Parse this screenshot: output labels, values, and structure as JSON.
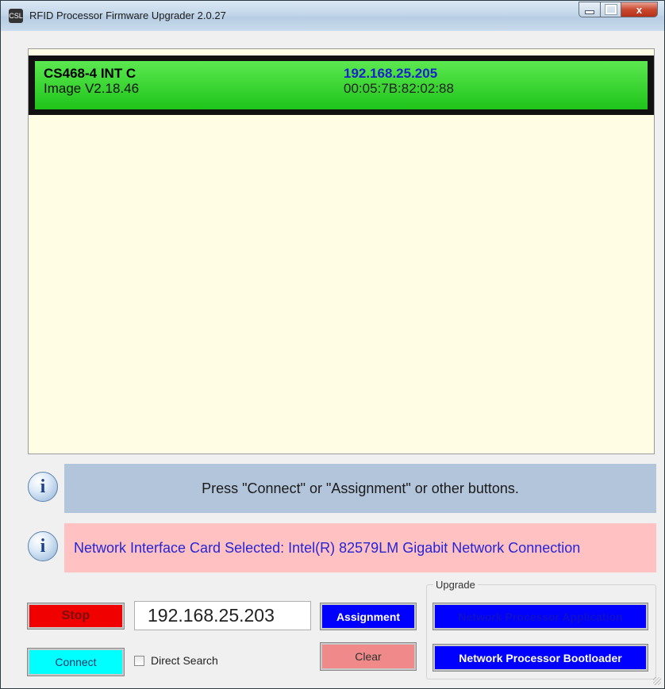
{
  "window": {
    "title": "RFID Processor Firmware Upgrader 2.0.27",
    "icon_text": "CSL",
    "close_glyph": "x"
  },
  "reader_list": {
    "items": [
      {
        "model": "CS468-4 INT C",
        "image_version": "Image V2.18.46",
        "ip_address": "192.168.25.205",
        "mac_address": "00:05:7B:82:02:88"
      }
    ]
  },
  "status": {
    "message": "Press \"Connect\" or \"Assignment\" or other buttons.",
    "background": "#b3c5da"
  },
  "nic": {
    "message": "Network Interface Card Selected: Intel(R) 82579LM Gigabit Network Connection",
    "background": "#ffc1c1",
    "text_color": "#2525d6"
  },
  "controls": {
    "stop_label": "Stop",
    "connect_label": "Connect",
    "ip_value": "192.168.25.203",
    "direct_search_label": "Direct Search",
    "direct_search_checked": false,
    "assignment_label": "Assignment",
    "clear_label": "Clear"
  },
  "upgrade": {
    "group_label": "Upgrade",
    "app_label": "Network Processor Application",
    "bootloader_label": "Network Processor Bootloader"
  },
  "icons": {
    "info": "i"
  }
}
